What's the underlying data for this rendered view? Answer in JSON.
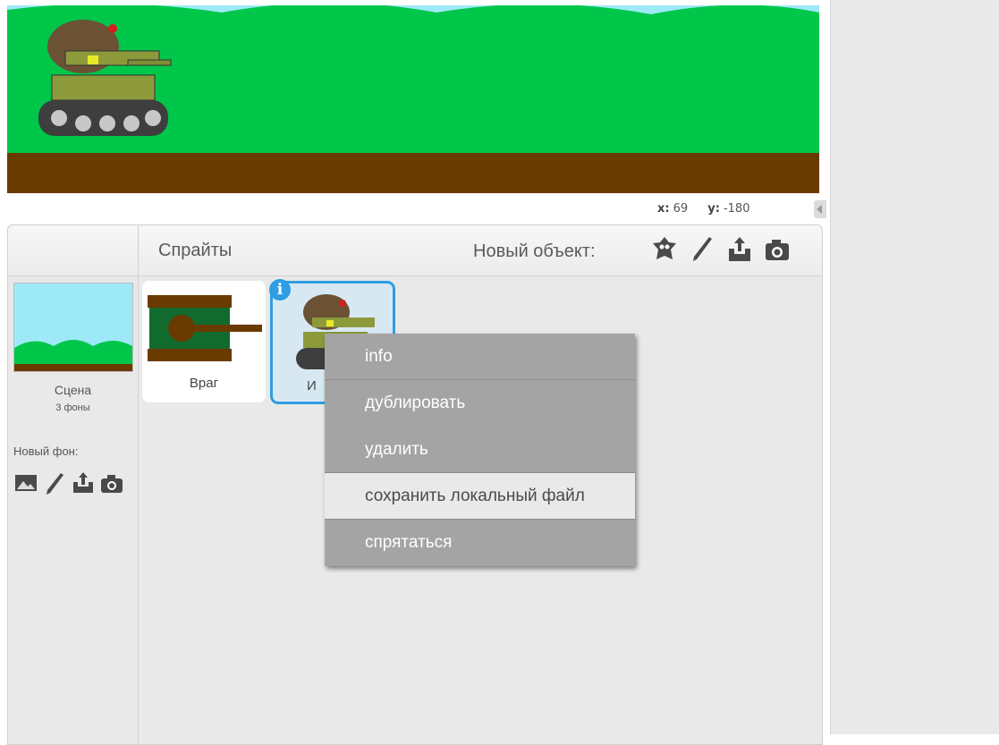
{
  "coords": {
    "x_label": "x:",
    "x_value": "69",
    "y_label": "y:",
    "y_value": "-180"
  },
  "sprites_pane": {
    "title": "Спрайты",
    "new_object_label": "Новый объект:",
    "new_object_tools": [
      "choose-sprite-icon",
      "paint-brush-icon",
      "upload-icon",
      "camera-icon"
    ]
  },
  "scene": {
    "label": "Сцена",
    "backdrops_count": "3 фоны",
    "new_backdrop_label": "Новый фон:",
    "new_backdrop_tools": [
      "landscape-icon",
      "paint-brush-icon",
      "upload-icon",
      "camera-icon"
    ]
  },
  "sprites": [
    {
      "name": "Враг",
      "selected": false
    },
    {
      "name": "И",
      "selected": true
    }
  ],
  "context_menu": {
    "items": [
      {
        "label": "info"
      },
      {
        "label": "дублировать"
      },
      {
        "label": "удалить"
      },
      {
        "label": "сохранить локальный файл",
        "hovered": true
      },
      {
        "label": "спрятаться"
      }
    ]
  },
  "colors": {
    "sky": "#9ee9f7",
    "grass": "#00c64a",
    "ground": "#6a3b00",
    "selection": "#2f9de2",
    "menu_bg": "#a4a4a4"
  }
}
